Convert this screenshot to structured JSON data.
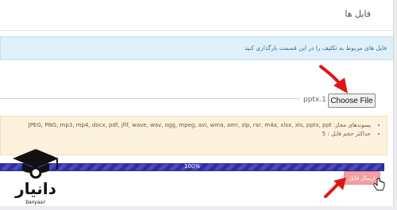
{
  "page": {
    "title": "فایل ها"
  },
  "info": {
    "text": "فایل های مربوط به تکلیف را در این قسمت بارگذاری کنید"
  },
  "file_input": {
    "selected_file": "pptx.1",
    "button_label": "Choose File"
  },
  "notice": {
    "allowed_formats": "پسوندهای مجاز: JPEG, PNG, mp3, mp4, docx, pdf, jfif, wave, wav, ogg, mpeg, avi, wma, amr, zip, rar, m4a, xlsx, xls, pptx, ppt",
    "max_size": "حداکثر حجم فایل : 5"
  },
  "upload_progress": {
    "label": "100%",
    "value": 1.0
  },
  "send_button": {
    "label": "ارسال فایل"
  },
  "watermark": {
    "brand": "دانیار",
    "brand_latin": "Danyaar"
  },
  "colors": {
    "annotation_arrow": "#e01515",
    "progress_bar": "#2f2fa3",
    "send_button": "#f0a0a0",
    "info_box": "#dff0fb",
    "warning_box": "#fcf2dd"
  },
  "icons": {
    "logo": "graduation-cap-icon",
    "cursor": "hand-pointer-icon",
    "annotations": "arrow-icon"
  }
}
